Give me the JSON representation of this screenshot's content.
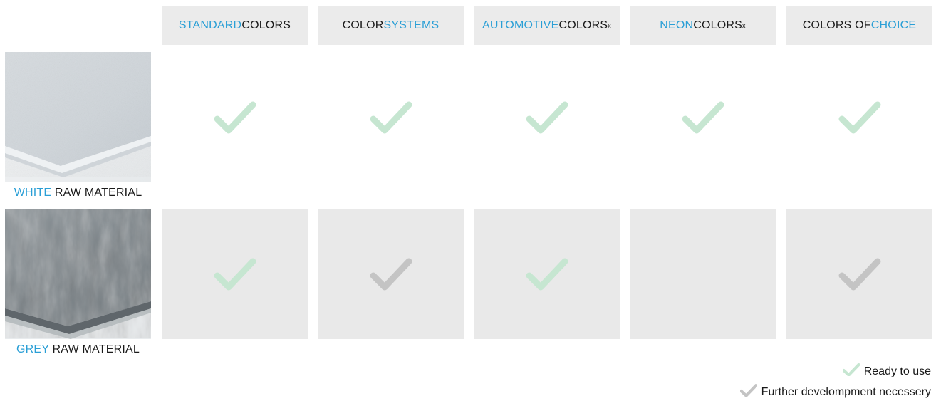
{
  "colors": {
    "accent": "#2a9fd6",
    "check_ready": "#c6e6d1",
    "check_further": "#c4c4c4",
    "cell_bg": "#e9e9e9"
  },
  "columns": [
    {
      "parts": [
        {
          "text": "STANDARD",
          "accent": true
        },
        {
          "text": " COLORS",
          "accent": false
        }
      ],
      "sup": ""
    },
    {
      "parts": [
        {
          "text": "COLOR ",
          "accent": false
        },
        {
          "text": "SYSTEMS",
          "accent": true
        }
      ],
      "sup": ""
    },
    {
      "parts": [
        {
          "text": "AUTOMOTIVE",
          "accent": true
        },
        {
          "text": " COLORS",
          "accent": false
        }
      ],
      "sup": "x"
    },
    {
      "parts": [
        {
          "text": "NEON",
          "accent": true
        },
        {
          "text": " COLORS",
          "accent": false
        }
      ],
      "sup": "x"
    },
    {
      "parts": [
        {
          "text": "COLORS OF ",
          "accent": false
        },
        {
          "text": "CHOICE",
          "accent": true
        }
      ],
      "sup": ""
    }
  ],
  "rows": [
    {
      "label_accent": "WHITE",
      "label_rest": " RAW MATERIAL",
      "shaded": false,
      "cells": [
        "ready",
        "ready",
        "ready",
        "ready",
        "ready"
      ]
    },
    {
      "label_accent": "GREY",
      "label_rest": " RAW MATERIAL",
      "shaded": true,
      "cells": [
        "ready",
        "further",
        "ready",
        "none",
        "further"
      ]
    }
  ],
  "legend": {
    "ready": "Ready to use",
    "further": "Further develompment necessery"
  }
}
